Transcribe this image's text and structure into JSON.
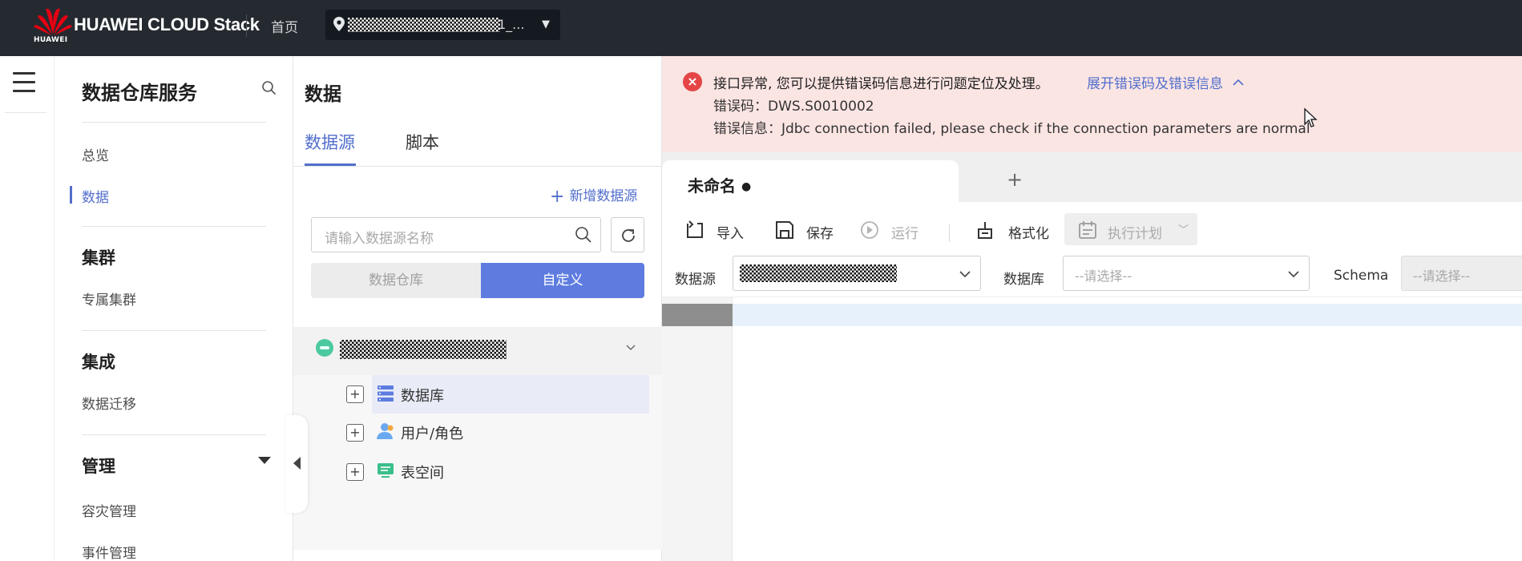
{
  "topbar": {
    "logo_sub": "HUAWEI",
    "brand": "HUAWEI CLOUD Stack",
    "home": "首页",
    "region_suffix": "1_...",
    "brand_color": "#252a30"
  },
  "service_nav": {
    "title": "数据仓库服务",
    "items": {
      "overview": "总览",
      "data": "数据",
      "cluster_group": "集群",
      "dedicated_cluster": "专属集群",
      "integration_group": "集成",
      "data_migration": "数据迁移",
      "management_group": "管理",
      "disaster_recovery": "容灾管理",
      "event_management": "事件管理"
    },
    "active_item": "数据",
    "accent_color": "#526ecc"
  },
  "data_panel": {
    "title": "数据",
    "tabs": [
      "数据源",
      "脚本"
    ],
    "active_tab": "数据源",
    "add_datasource": "新增数据源",
    "search_placeholder": "请输入数据源名称",
    "segments": [
      "数据仓库",
      "自定义"
    ],
    "active_segment": "自定义",
    "tree_children": [
      "数据库",
      "用户/角色",
      "表空间"
    ]
  },
  "error_banner": {
    "message": "接口异常, 您可以提供错误码信息进行问题定位及处理。",
    "link": "展开错误码及错误信息",
    "code_line": "错误码：DWS.S0010002",
    "info_line": "错误信息：Jdbc connection failed, please check if the connection parameters are normal"
  },
  "editor": {
    "tab_label": "未命名",
    "tab_modified_marker": "●",
    "toolbar": {
      "import": "导入",
      "save": "保存",
      "run": "运行",
      "format": "格式化",
      "plan": "执行计划"
    },
    "fields": {
      "datasource_label": "数据源",
      "database_label": "数据库",
      "database_placeholder": "--请选择--",
      "schema_label": "Schema",
      "schema_placeholder": "--请选择--"
    }
  }
}
